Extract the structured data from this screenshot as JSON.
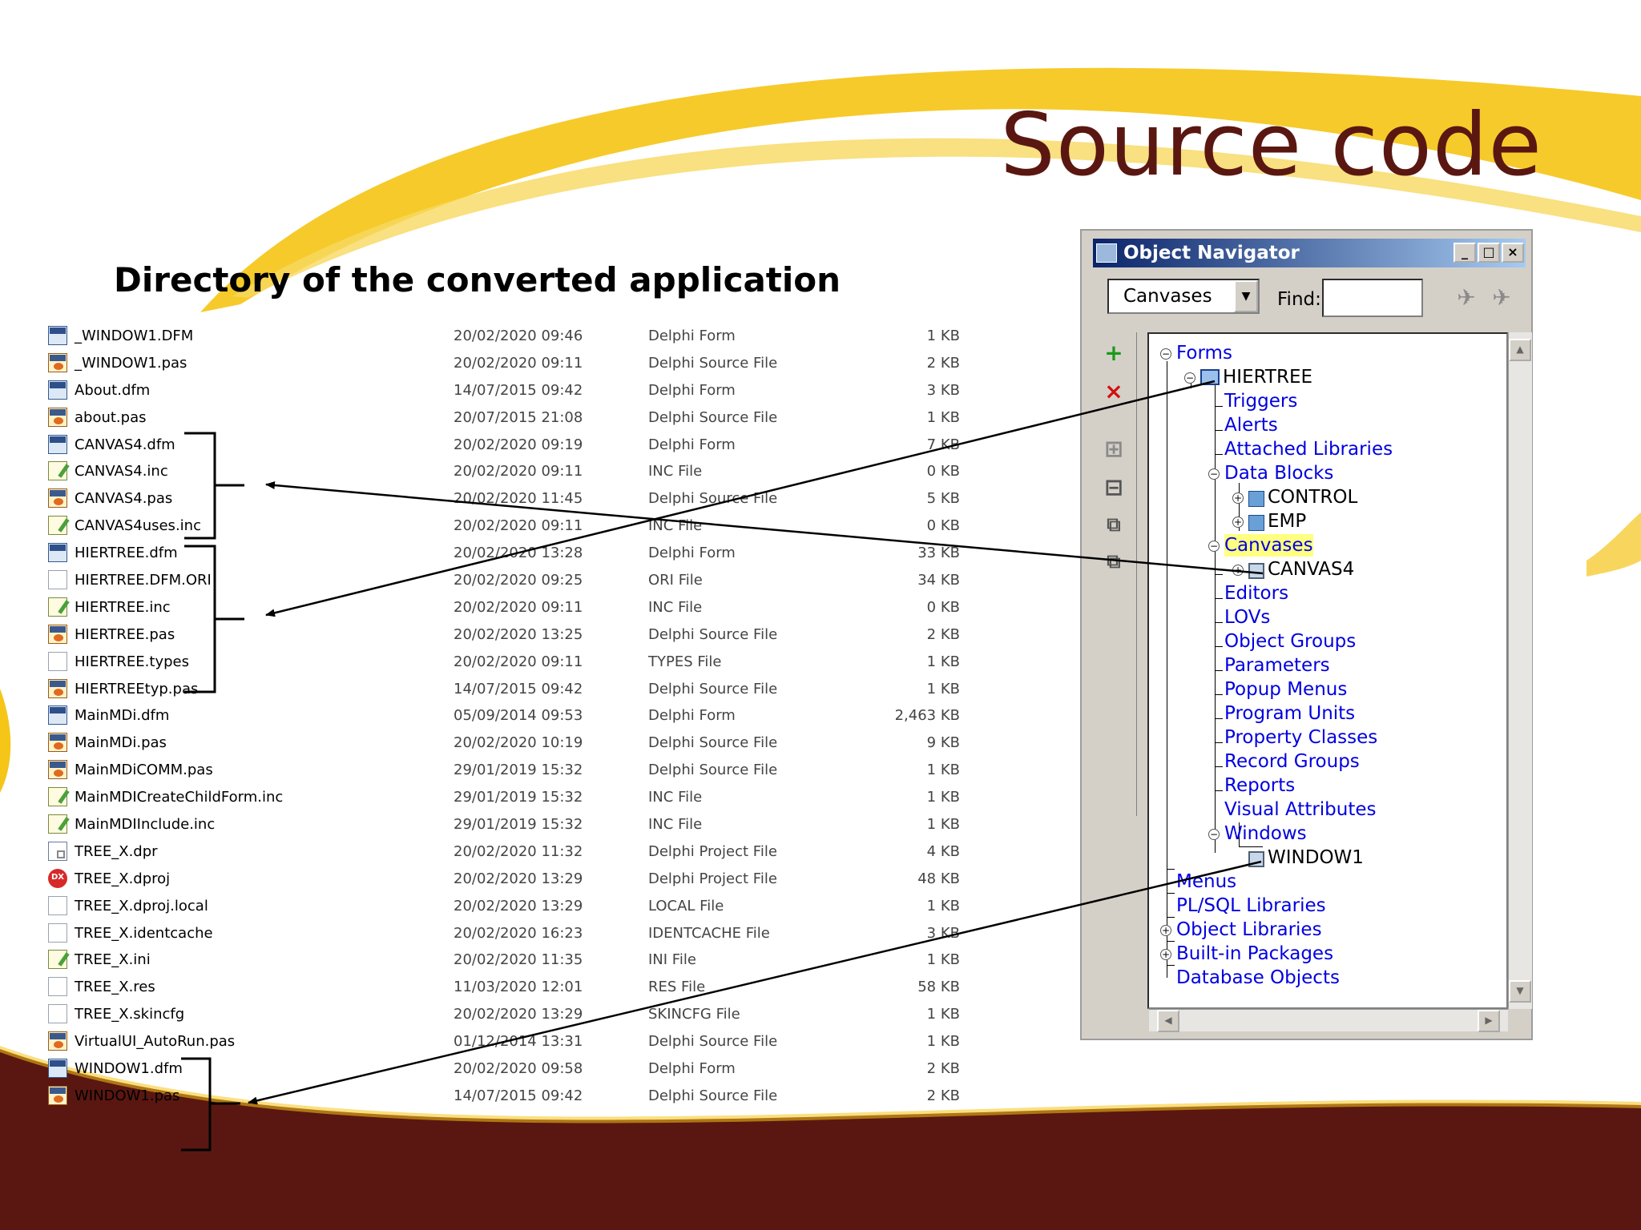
{
  "slide": {
    "title": "Source code",
    "subtitle": "Directory of the converted application",
    "colors": {
      "title": "#5a1711",
      "swoosh": "#f5c518",
      "footer_band": "#5a1711"
    }
  },
  "file_list": [
    {
      "name": "_WINDOW1.DFM",
      "date": "20/02/2020 09:46",
      "type": "Delphi Form",
      "size": "1 KB",
      "icon": "delphi-form-icon"
    },
    {
      "name": "_WINDOW1.pas",
      "date": "20/02/2020 09:11",
      "type": "Delphi Source File",
      "size": "2 KB",
      "icon": "delphi-source-icon"
    },
    {
      "name": "About.dfm",
      "date": "14/07/2015 09:42",
      "type": "Delphi Form",
      "size": "3 KB",
      "icon": "delphi-form-icon"
    },
    {
      "name": "about.pas",
      "date": "20/07/2015 21:08",
      "type": "Delphi Source File",
      "size": "1 KB",
      "icon": "delphi-source-icon"
    },
    {
      "name": "CANVAS4.dfm",
      "date": "20/02/2020 09:19",
      "type": "Delphi Form",
      "size": "7 KB",
      "icon": "delphi-form-icon"
    },
    {
      "name": "CANVAS4.inc",
      "date": "20/02/2020 09:11",
      "type": "INC File",
      "size": "0 KB",
      "icon": "include-file-icon"
    },
    {
      "name": "CANVAS4.pas",
      "date": "20/02/2020 11:45",
      "type": "Delphi Source File",
      "size": "5 KB",
      "icon": "delphi-source-icon"
    },
    {
      "name": "CANVAS4uses.inc",
      "date": "20/02/2020 09:11",
      "type": "INC File",
      "size": "0 KB",
      "icon": "include-file-icon"
    },
    {
      "name": "HIERTREE.dfm",
      "date": "20/02/2020 13:28",
      "type": "Delphi Form",
      "size": "33 KB",
      "icon": "delphi-form-icon"
    },
    {
      "name": "HIERTREE.DFM.ORI",
      "date": "20/02/2020 09:25",
      "type": "ORI File",
      "size": "34 KB",
      "icon": "blank-file-icon"
    },
    {
      "name": "HIERTREE.inc",
      "date": "20/02/2020 09:11",
      "type": "INC File",
      "size": "0 KB",
      "icon": "include-file-icon"
    },
    {
      "name": "HIERTREE.pas",
      "date": "20/02/2020 13:25",
      "type": "Delphi Source File",
      "size": "2 KB",
      "icon": "delphi-source-icon"
    },
    {
      "name": "HIERTREE.types",
      "date": "20/02/2020 09:11",
      "type": "TYPES File",
      "size": "1 KB",
      "icon": "blank-file-icon"
    },
    {
      "name": "HIERTREEtyp.pas",
      "date": "14/07/2015 09:42",
      "type": "Delphi Source File",
      "size": "1 KB",
      "icon": "delphi-source-icon"
    },
    {
      "name": "MainMDi.dfm",
      "date": "05/09/2014 09:53",
      "type": "Delphi Form",
      "size": "2,463 KB",
      "icon": "delphi-form-icon"
    },
    {
      "name": "MainMDi.pas",
      "date": "20/02/2020 10:19",
      "type": "Delphi Source File",
      "size": "9 KB",
      "icon": "delphi-source-icon"
    },
    {
      "name": "MainMDiCOMM.pas",
      "date": "29/01/2019 15:32",
      "type": "Delphi Source File",
      "size": "1 KB",
      "icon": "delphi-source-icon"
    },
    {
      "name": "MainMDICreateChildForm.inc",
      "date": "29/01/2019 15:32",
      "type": "INC File",
      "size": "1 KB",
      "icon": "include-file-icon"
    },
    {
      "name": "MainMDIInclude.inc",
      "date": "29/01/2019 15:32",
      "type": "INC File",
      "size": "1 KB",
      "icon": "include-file-icon"
    },
    {
      "name": "TREE_X.dpr",
      "date": "20/02/2020 11:32",
      "type": "Delphi Project File",
      "size": "4 KB",
      "icon": "delphi-project-icon"
    },
    {
      "name": "TREE_X.dproj",
      "date": "20/02/2020 13:29",
      "type": "Delphi Project File",
      "size": "48 KB",
      "icon": "dx-project-icon"
    },
    {
      "name": "TREE_X.dproj.local",
      "date": "20/02/2020 13:29",
      "type": "LOCAL File",
      "size": "1 KB",
      "icon": "blank-file-icon"
    },
    {
      "name": "TREE_X.identcache",
      "date": "20/02/2020 16:23",
      "type": "IDENTCACHE File",
      "size": "3 KB",
      "icon": "blank-file-icon"
    },
    {
      "name": "TREE_X.ini",
      "date": "20/02/2020 11:35",
      "type": "INI File",
      "size": "1 KB",
      "icon": "include-file-icon"
    },
    {
      "name": "TREE_X.res",
      "date": "11/03/2020 12:01",
      "type": "RES File",
      "size": "58 KB",
      "icon": "blank-file-icon"
    },
    {
      "name": "TREE_X.skincfg",
      "date": "20/02/2020 13:29",
      "type": "SKINCFG File",
      "size": "1 KB",
      "icon": "blank-file-icon"
    },
    {
      "name": "VirtualUI_AutoRun.pas",
      "date": "01/12/2014 13:31",
      "type": "Delphi Source File",
      "size": "1 KB",
      "icon": "delphi-source-icon"
    },
    {
      "name": "WINDOW1.dfm",
      "date": "20/02/2020 09:58",
      "type": "Delphi Form",
      "size": "2 KB",
      "icon": "delphi-form-icon"
    },
    {
      "name": "WINDOW1.pas",
      "date": "14/07/2015 09:42",
      "type": "Delphi Source File",
      "size": "2 KB",
      "icon": "delphi-source-icon"
    }
  ],
  "navigator": {
    "title": "Object Navigator",
    "combo_value": "Canvases",
    "find_label": "Find:",
    "find_value": "",
    "window_buttons": {
      "minimize": "_",
      "maximize": "□",
      "close": "×"
    },
    "toolbar": {
      "create": "+",
      "delete": "×",
      "expand_all": "⊞",
      "collapse_all": "⊟"
    },
    "tree": {
      "forms": "Forms",
      "hiertree": "HIERTREE",
      "triggers": "Triggers",
      "alerts": "Alerts",
      "attached_libraries": "Attached Libraries",
      "data_blocks": "Data Blocks",
      "control": "CONTROL",
      "emp": "EMP",
      "canvases": "Canvases",
      "canvas4": "CANVAS4",
      "editors": "Editors",
      "lovs": "LOVs",
      "object_groups": "Object Groups",
      "parameters": "Parameters",
      "popup_menus": "Popup Menus",
      "program_units": "Program Units",
      "property_classes": "Property Classes",
      "record_groups": "Record Groups",
      "reports": "Reports",
      "visual_attributes": "Visual Attributes",
      "windows": "Windows",
      "window1": "WINDOW1",
      "menus": "Menus",
      "plsql_libraries": "PL/SQL Libraries",
      "object_libraries": "Object Libraries",
      "builtin_packages": "Built-in Packages",
      "database_objects": "Database Objects"
    }
  }
}
